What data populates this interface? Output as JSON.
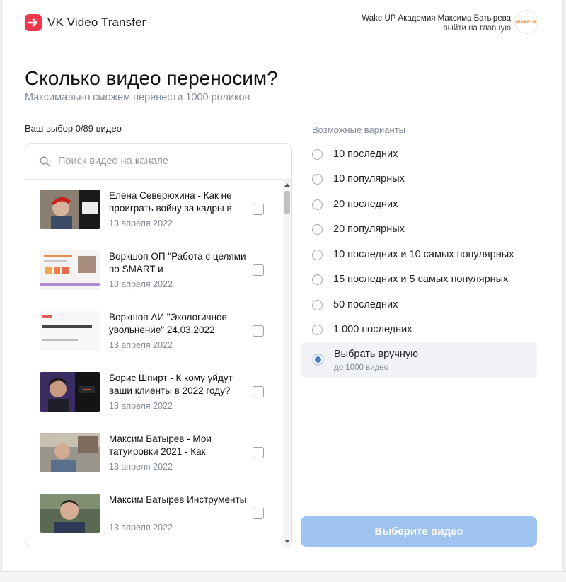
{
  "app": {
    "name": "VK Video Transfer"
  },
  "account": {
    "name": "Wake UP Академия Максима Батырева",
    "home_link": "выйти на главную",
    "avatar_text": "WAKEUP"
  },
  "page": {
    "title": "Сколько видео переносим?",
    "subtitle": "Максимально сможем перенести 1000 роликов"
  },
  "selection": {
    "label": "Ваш выбор 0/89 видео"
  },
  "search": {
    "placeholder": "Поиск видео на канале"
  },
  "videos": [
    {
      "title": "Елена Северюхина - Как не проиграть войну за кадры в",
      "date": "13 апреля 2022"
    },
    {
      "title": "Воркшоп ОП \"Работа с целями по SMART и",
      "date": "13 апреля 2022"
    },
    {
      "title": "Воркшоп АИ \"Экологичное увольнение\" 24.03.2022",
      "date": "13 апреля 2022"
    },
    {
      "title": "Борис Шпирт - К кому уйдут ваши клиенты в 2022 году?",
      "date": "13 апреля 2022"
    },
    {
      "title": "Максим Батырев - Мои татуировки 2021 - Как",
      "date": "13 апреля 2022"
    },
    {
      "title": "Максим Батырев Инструменты",
      "date": "13 апреля 2022"
    }
  ],
  "options": {
    "label": "Возможные варианты",
    "items": [
      "10 последних",
      "10 популярных",
      "20 последних",
      "20 популярных",
      "10 последних и 10 самых популярных",
      "15 последних и 5 самых популярных",
      "50 последних",
      "1 000 последних"
    ],
    "manual": {
      "label": "Выбрать вручную",
      "sublabel": "до 1000 видео"
    }
  },
  "submit": {
    "label": "Выберите видео"
  },
  "colors": {
    "accent": "#9ec3ee",
    "selected_radio": "#4a7fc7",
    "logo": "#f0384f"
  }
}
